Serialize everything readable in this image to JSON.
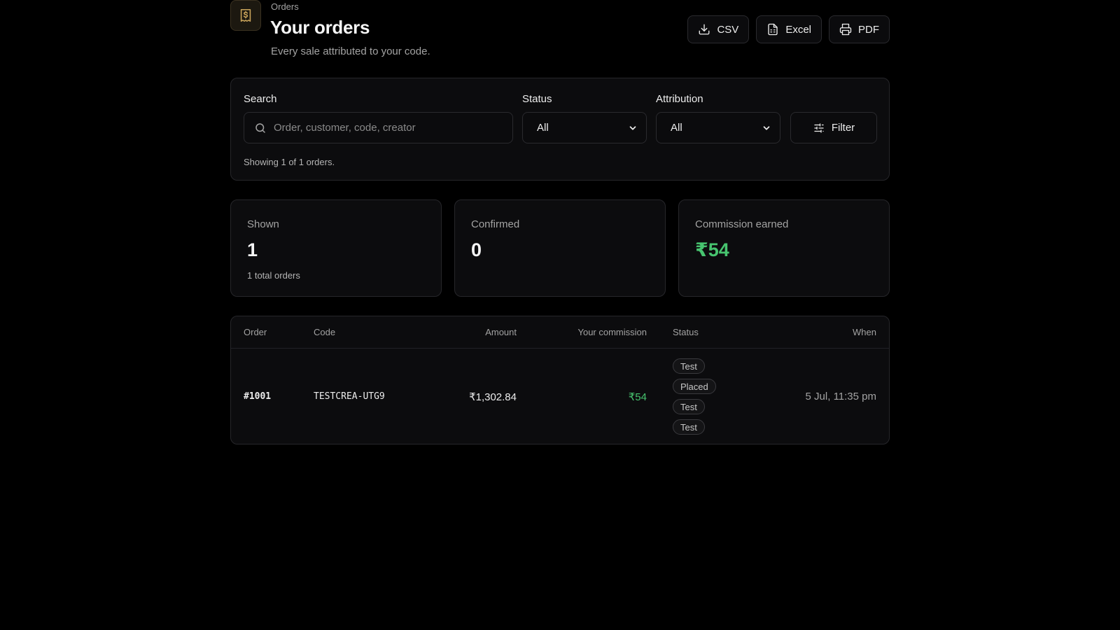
{
  "header": {
    "eyebrow": "Orders",
    "title": "Your orders",
    "subtitle": "Every sale attributed to your code.",
    "icon": "receipt-icon"
  },
  "exports": {
    "csv_label": "CSV",
    "excel_label": "Excel",
    "pdf_label": "PDF"
  },
  "filters": {
    "search_label": "Search",
    "search_placeholder": "Order, customer, code, creator",
    "search_value": "",
    "status_label": "Status",
    "status_value": "All",
    "attribution_label": "Attribution",
    "attribution_value": "All",
    "filter_button": "Filter",
    "showing_text": "Showing 1 of 1 orders."
  },
  "stats": [
    {
      "label": "Shown",
      "value": "1",
      "note": "1 total orders"
    },
    {
      "label": "Confirmed",
      "value": "0",
      "note": ""
    },
    {
      "label": "Commission earned",
      "value": "₹54",
      "note": ""
    }
  ],
  "table": {
    "headers": {
      "order": "Order",
      "code": "Code",
      "amount": "Amount",
      "commission": "Your commission",
      "status": "Status",
      "when": "When"
    },
    "rows": [
      {
        "order": "#1001",
        "code": "TESTCREA-UTG9",
        "amount": "₹1,302.84",
        "commission": "₹54",
        "badges": [
          "Test",
          "Placed",
          "Test",
          "Test"
        ],
        "when": "5 Jul, 11:35 pm"
      }
    ]
  },
  "colors": {
    "accent_green": "#47c46f",
    "icon_gold": "#c9a35a",
    "background": "#000000",
    "card": "#0c0c0e"
  }
}
